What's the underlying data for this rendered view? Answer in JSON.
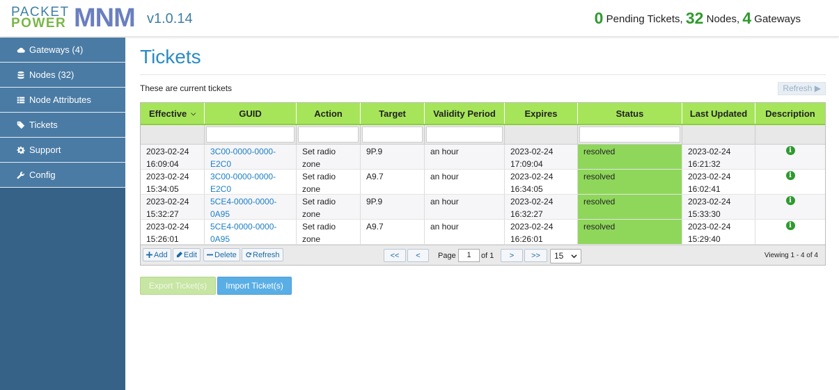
{
  "header": {
    "logo_top": "PACKET",
    "logo_bottom": "POWER",
    "logo_product": "MNM",
    "version": "v1.0.14",
    "stats": {
      "pending_tickets": "0",
      "pending_tickets_label": "Pending Tickets,",
      "nodes": "32",
      "nodes_label": "Nodes,",
      "gateways": "4",
      "gateways_label": "Gateways"
    }
  },
  "sidebar": {
    "items": [
      {
        "label": "Gateways (4)",
        "icon": "cloud-icon"
      },
      {
        "label": "Nodes (32)",
        "icon": "database-icon"
      },
      {
        "label": "Node Attributes",
        "icon": "list-icon"
      },
      {
        "label": "Tickets",
        "icon": "tag-icon"
      },
      {
        "label": "Support",
        "icon": "gear-icon"
      },
      {
        "label": "Config",
        "icon": "wrench-icon"
      }
    ]
  },
  "page": {
    "title": "Tickets",
    "subtitle": "These are current tickets",
    "refresh_label": "Refresh ▶"
  },
  "table": {
    "columns": [
      "Effective",
      "GUID",
      "Action",
      "Target",
      "Validity Period",
      "Expires",
      "Status",
      "Last Updated",
      "Description"
    ],
    "rows": [
      {
        "effective_date": "2023-02-24",
        "effective_time": "16:09:04",
        "guid_1": "3C00-0000-0000-",
        "guid_2": "E2C0",
        "action_1": "Set radio",
        "action_2": "zone",
        "target": "9P.9",
        "validity": "an hour",
        "expires_date": "2023-02-24",
        "expires_time": "17:09:04",
        "status": "resolved",
        "updated_date": "2023-02-24",
        "updated_time": "16:21:32"
      },
      {
        "effective_date": "2023-02-24",
        "effective_time": "15:34:05",
        "guid_1": "3C00-0000-0000-",
        "guid_2": "E2C0",
        "action_1": "Set radio",
        "action_2": "zone",
        "target": "A9.7",
        "validity": "an hour",
        "expires_date": "2023-02-24",
        "expires_time": "16:34:05",
        "status": "resolved",
        "updated_date": "2023-02-24",
        "updated_time": "16:02:41"
      },
      {
        "effective_date": "2023-02-24",
        "effective_time": "15:32:27",
        "guid_1": "5CE4-0000-0000-0A95",
        "guid_2": "",
        "action_1": "Set radio",
        "action_2": "zone",
        "target": "9P.9",
        "validity": "an hour",
        "expires_date": "2023-02-24",
        "expires_time": "16:32:27",
        "status": "resolved",
        "updated_date": "2023-02-24",
        "updated_time": "15:33:30"
      },
      {
        "effective_date": "2023-02-24",
        "effective_time": "15:26:01",
        "guid_1": "5CE4-0000-0000-0A95",
        "guid_2": "",
        "action_1": "Set radio",
        "action_2": "zone",
        "target": "A9.7",
        "validity": "an hour",
        "expires_date": "2023-02-24",
        "expires_time": "16:26:01",
        "status": "resolved",
        "updated_date": "2023-02-24",
        "updated_time": "15:29:40"
      }
    ]
  },
  "pager": {
    "add": "Add",
    "edit": "Edit",
    "delete": "Delete",
    "refresh": "Refresh",
    "first": "<<",
    "prev": "<",
    "next": ">",
    "last": ">>",
    "page_label": "Page",
    "page_value": "1",
    "of_label": "of 1",
    "page_size": "15",
    "viewing": "Viewing 1 - 4 of 4"
  },
  "actions": {
    "export": "Export Ticket(s)",
    "import": "Import Ticket(s)"
  },
  "colors": {
    "accent": "#2a8bc4",
    "header_green": "#a6e55a",
    "status_green": "#8fd75b",
    "sidebar": "#4a7ba4"
  }
}
